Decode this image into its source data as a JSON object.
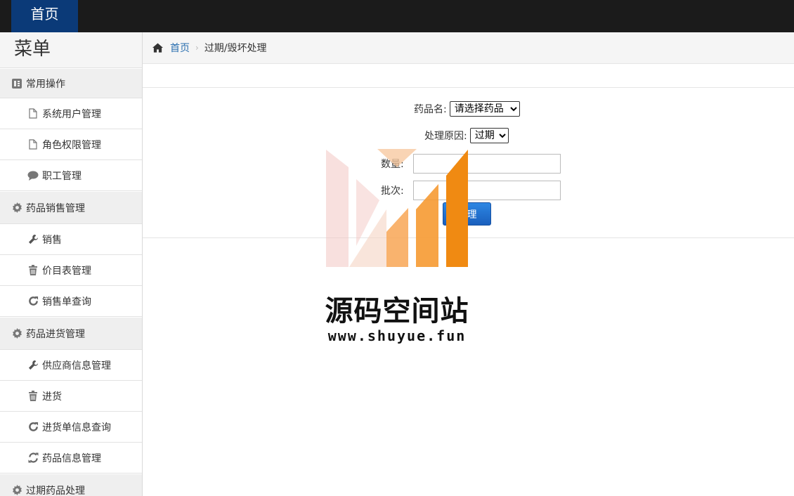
{
  "topbar": {
    "home_label": "首页"
  },
  "sidebar": {
    "title": "菜单",
    "groups": [
      {
        "label": "常用操作",
        "icon": "list-icon",
        "items": [
          {
            "label": "系统用户管理",
            "icon": "file-icon"
          },
          {
            "label": "角色权限管理",
            "icon": "file-icon"
          },
          {
            "label": "职工管理",
            "icon": "comment-icon"
          }
        ]
      },
      {
        "label": "药品销售管理",
        "icon": "gear-icon",
        "items": [
          {
            "label": "销售",
            "icon": "wrench-icon"
          },
          {
            "label": "价目表管理",
            "icon": "trash-icon"
          },
          {
            "label": "销售单查询",
            "icon": "refresh-icon"
          }
        ]
      },
      {
        "label": "药品进货管理",
        "icon": "gear-icon",
        "items": [
          {
            "label": "供应商信息管理",
            "icon": "wrench-icon"
          },
          {
            "label": "进货",
            "icon": "trash-icon"
          },
          {
            "label": "进货单信息查询",
            "icon": "refresh-icon"
          },
          {
            "label": "药品信息管理",
            "icon": "sync-icon"
          }
        ]
      },
      {
        "label": "过期药品处理",
        "icon": "gear-icon",
        "items": []
      }
    ]
  },
  "breadcrumb": {
    "home": "首页",
    "current": "过期/毁坏处理"
  },
  "form": {
    "drug_label": "药品名:",
    "drug_selected": "请选择药品",
    "reason_label": "处理原因:",
    "reason_selected": "过期",
    "qty_label": "数量:",
    "qty_value": "",
    "batch_label": "批次:",
    "batch_value": "",
    "submit_label": "处理"
  },
  "watermark": {
    "title": "源码空间站",
    "url": "www.shuyue.fun"
  }
}
